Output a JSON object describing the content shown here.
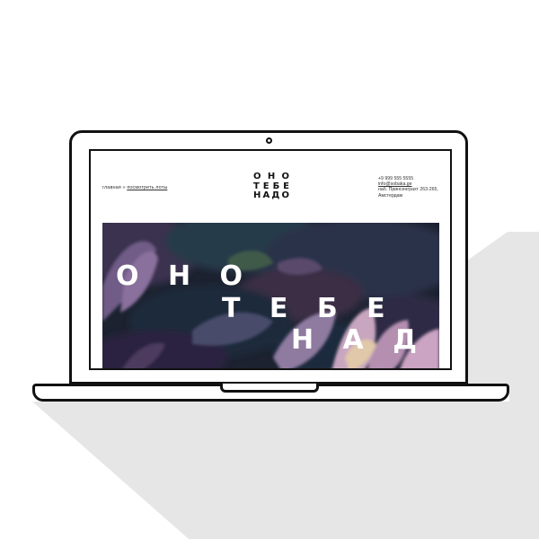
{
  "site": {
    "breadcrumb": {
      "home": "главная",
      "separator": "»",
      "current": "посмотреть лоты"
    },
    "logo": {
      "rows": [
        [
          "О",
          "Н",
          "О"
        ],
        [
          "Т",
          "Е",
          "Б",
          "Е"
        ],
        [
          "Н",
          "А",
          "Д",
          "О"
        ]
      ]
    },
    "contact": {
      "phone": "+9 999 555 5555",
      "email": "info@sobaka.ge",
      "address_line1": "наб. Принсенграхт 263-265,",
      "address_line2": "Амстердам"
    },
    "hero": {
      "line1": "О Н О",
      "line2": "Т Е Б Е",
      "line3": "Н А Д О"
    }
  },
  "colors": {
    "outline": "#111111",
    "shadow": "#e6e6e6",
    "hero_dark": "#1c2230",
    "hero_purple": "#8a6f9c",
    "hero_pink": "#c9a6c0"
  }
}
